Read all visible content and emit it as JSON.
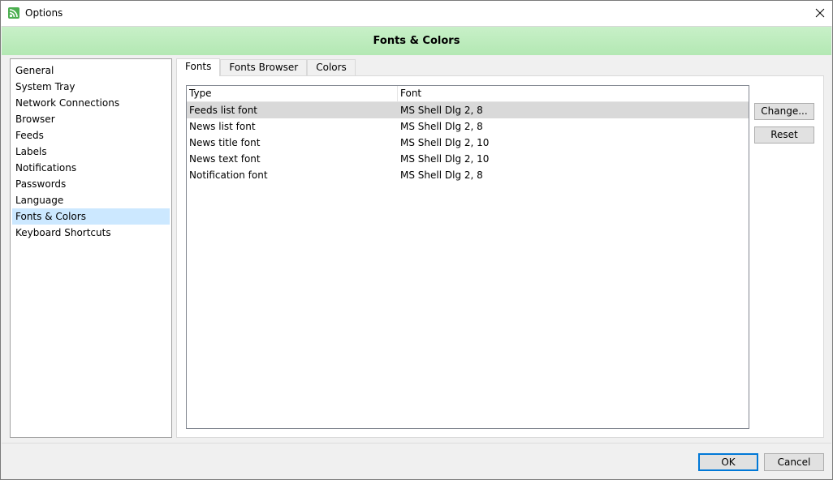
{
  "window": {
    "title": "Options",
    "icon": "rss-feed-icon",
    "accent_color": "#0078d7"
  },
  "header": {
    "title": "Fonts & Colors",
    "gradient_color": "#b3e8b3"
  },
  "sidebar": {
    "items": [
      {
        "label": "General"
      },
      {
        "label": "System Tray"
      },
      {
        "label": "Network Connections"
      },
      {
        "label": "Browser"
      },
      {
        "label": "Feeds"
      },
      {
        "label": "Labels"
      },
      {
        "label": "Notifications"
      },
      {
        "label": "Passwords"
      },
      {
        "label": "Language"
      },
      {
        "label": "Fonts & Colors",
        "selected": true
      },
      {
        "label": "Keyboard Shortcuts"
      }
    ]
  },
  "tabs": [
    {
      "label": "Fonts",
      "active": true
    },
    {
      "label": "Fonts Browser"
    },
    {
      "label": "Colors"
    }
  ],
  "table": {
    "columns": [
      "Type",
      "Font"
    ],
    "rows": [
      {
        "type": "Feeds list font",
        "font": "MS Shell Dlg 2, 8",
        "selected": true
      },
      {
        "type": "News list font",
        "font": "MS Shell Dlg 2, 8"
      },
      {
        "type": "News title font",
        "font": "MS Shell Dlg 2, 10"
      },
      {
        "type": "News text font",
        "font": "MS Shell Dlg 2, 10"
      },
      {
        "type": "Notification font",
        "font": "MS Shell Dlg 2, 8"
      }
    ]
  },
  "buttons": {
    "change": "Change...",
    "reset": "Reset",
    "ok": "OK",
    "cancel": "Cancel"
  }
}
